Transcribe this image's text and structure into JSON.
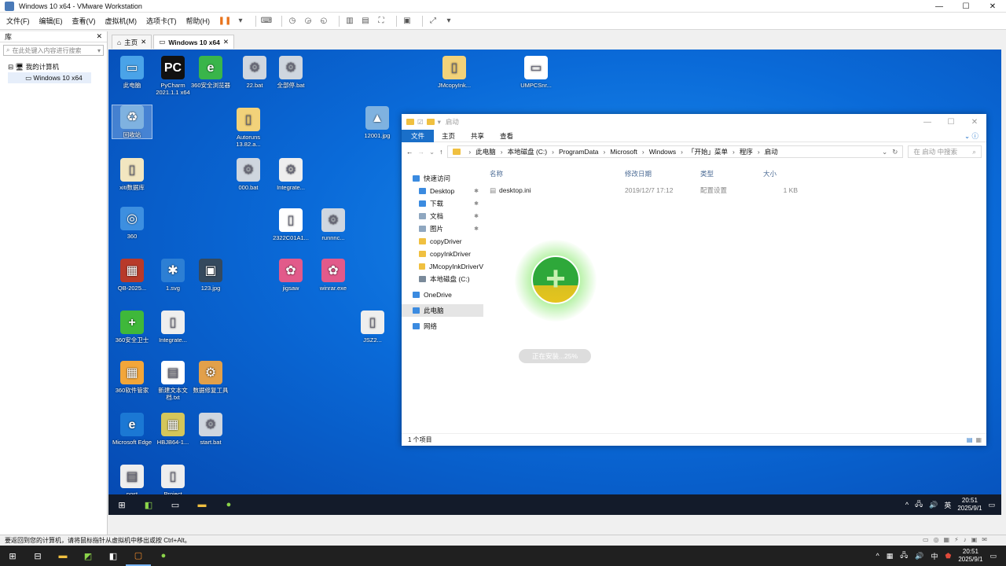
{
  "window": {
    "title": "Windows 10 x64 - VMware Workstation"
  },
  "menu": {
    "items": [
      "文件(F)",
      "编辑(E)",
      "查看(V)",
      "虚拟机(M)",
      "选项卡(T)",
      "帮助(H)"
    ]
  },
  "library": {
    "header": "库",
    "search_placeholder": "在此处键入内容进行搜索",
    "root": "我的计算机",
    "child": "Windows 10 x64"
  },
  "tabs": [
    {
      "label": "主页"
    },
    {
      "label": "Windows 10 x64"
    }
  ],
  "desktop": {
    "icons": [
      {
        "label": "此电脑",
        "color": "#4aa3e8",
        "glyph": "▭"
      },
      {
        "label": "PyCharm 2021.1.1 x64",
        "color": "#111111",
        "glyph": "PC"
      },
      {
        "label": "360安全浏览器",
        "color": "#39b54a",
        "glyph": "e"
      },
      {
        "label": "22.bat",
        "color": "#cfd6df",
        "glyph": "⚙"
      },
      {
        "label": "全部停.bat",
        "color": "#cfd6df",
        "glyph": "⚙"
      },
      {
        "label": "JMcopyInk...",
        "color": "#f2d27a",
        "glyph": "▯"
      },
      {
        "label": "UMPCSnr...",
        "color": "#ffffff",
        "glyph": "▭"
      },
      {
        "label": "回收站",
        "color": "#7fb2e0",
        "glyph": "♻"
      },
      {
        "label": "Autoruns 13.82.a...",
        "color": "#f2d27a",
        "glyph": "▯"
      },
      {
        "label": "12001.jpg",
        "color": "#7fb2e0",
        "glyph": "▲"
      },
      {
        "label": "xiti数据库",
        "color": "#f2e6c0",
        "glyph": "▯"
      },
      {
        "label": "000.bat",
        "color": "#cfd6df",
        "glyph": "⚙"
      },
      {
        "label": "Integrate...",
        "color": "#eeeeee",
        "glyph": "⚙"
      },
      {
        "label": "360",
        "color": "#3d8fe0",
        "glyph": "◎"
      },
      {
        "label": "2322C01A1...",
        "color": "#ffffff",
        "glyph": "▯"
      },
      {
        "label": "runnnc...",
        "color": "#cfd6df",
        "glyph": "⚙"
      },
      {
        "label": "QB-2025...",
        "color": "#b83a2a",
        "glyph": "▦"
      },
      {
        "label": "1.svg",
        "color": "#2d7fd4",
        "glyph": "✱"
      },
      {
        "label": "123.jpg",
        "color": "#34495e",
        "glyph": "▣"
      },
      {
        "label": "jigsaw",
        "color": "#e25a8a",
        "glyph": "✿"
      },
      {
        "label": "winrar.exe",
        "color": "#e25a8a",
        "glyph": "✿"
      },
      {
        "label": "360安全卫士",
        "color": "#3fb83a",
        "glyph": "+"
      },
      {
        "label": "Integrate...",
        "color": "#eeeeee",
        "glyph": "▯"
      },
      {
        "label": "JSZ2...",
        "color": "#eeeeee",
        "glyph": "▯"
      },
      {
        "label": "360软件管家",
        "color": "#f2a63a",
        "glyph": "▦"
      },
      {
        "label": "新建文本文档.txt",
        "color": "#ffffff",
        "glyph": "▤"
      },
      {
        "label": "数据修复工具",
        "color": "#e2a04a",
        "glyph": "⚙"
      },
      {
        "label": "Microsoft Edge",
        "color": "#1b78d4",
        "glyph": "e"
      },
      {
        "label": "HBJB64-1...",
        "color": "#d4c65a",
        "glyph": "▦"
      },
      {
        "label": "start.bat",
        "color": "#cfd6df",
        "glyph": "⚙"
      },
      {
        "label": "post",
        "color": "#eeeeee",
        "glyph": "▤"
      },
      {
        "label": "Project",
        "color": "#eeeeee",
        "glyph": "▯"
      }
    ]
  },
  "explorer": {
    "title": "启动",
    "ribbon": [
      "文件",
      "主页",
      "共享",
      "查看"
    ],
    "address": [
      "此电脑",
      "本地磁盘 (C:)",
      "ProgramData",
      "Microsoft",
      "Windows",
      "「开始」菜单",
      "程序",
      "启动"
    ],
    "search_placeholder": "在 启动 中搜索",
    "nav": [
      {
        "label": "快速访问",
        "type": "head",
        "color": "#3b8be0"
      },
      {
        "label": "Desktop",
        "type": "sub",
        "pin": true,
        "color": "#3b8be0"
      },
      {
        "label": "下载",
        "type": "sub",
        "pin": true,
        "color": "#3b8be0"
      },
      {
        "label": "文档",
        "type": "sub",
        "pin": true,
        "color": "#8fa7c0"
      },
      {
        "label": "图片",
        "type": "sub",
        "pin": true,
        "color": "#8fa7c0"
      },
      {
        "label": "copyDriver",
        "type": "sub",
        "color": "#f0c040"
      },
      {
        "label": "copyInkDriver",
        "type": "sub",
        "color": "#f0c040"
      },
      {
        "label": "JMcopyInkDriverV",
        "type": "sub",
        "color": "#f0c040"
      },
      {
        "label": "本地磁盘 (C:)",
        "type": "sub",
        "color": "#7a8a9a"
      },
      {
        "label": "OneDrive",
        "type": "head",
        "color": "#3b8be0"
      },
      {
        "label": "此电脑",
        "type": "head",
        "color": "#3b8be0",
        "selected": true
      },
      {
        "label": "网络",
        "type": "head",
        "color": "#3b8be0"
      }
    ],
    "columns": [
      "名称",
      "修改日期",
      "类型",
      "大小"
    ],
    "files": [
      {
        "name": "desktop.ini",
        "date": "2019/12/7 17:12",
        "type": "配置设置",
        "size": "1 KB"
      }
    ],
    "status": "1 个项目"
  },
  "installer": {
    "progress_text": "正在安装...25%",
    "progress": 25
  },
  "guest_taskbar": {
    "time": "20:51",
    "date": "2025/9/1",
    "ime": "英"
  },
  "vm_status": {
    "text": "要返回到您的计算机，请将鼠标指针从虚拟机中移出或按 Ctrl+Alt。"
  },
  "host_taskbar": {
    "time": "20:51",
    "date": "2025/9/1",
    "ime": "中"
  }
}
